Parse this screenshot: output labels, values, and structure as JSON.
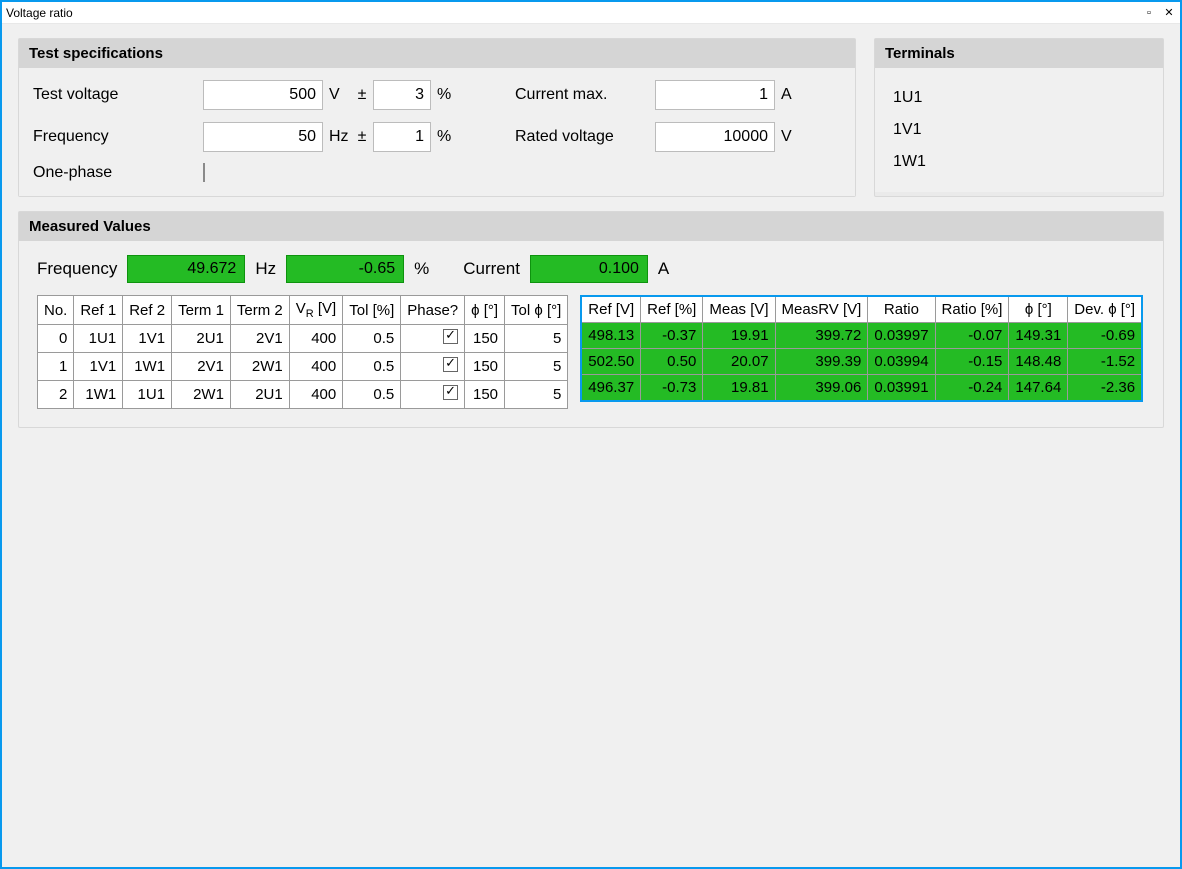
{
  "window": {
    "title": "Voltage ratio"
  },
  "specs": {
    "header": "Test specifications",
    "labels": {
      "test_voltage": "Test voltage",
      "frequency": "Frequency",
      "one_phase": "One-phase",
      "current_max": "Current max.",
      "rated_voltage": "Rated voltage"
    },
    "test_voltage": "500",
    "test_voltage_unit": "V",
    "test_voltage_tol": "3",
    "test_voltage_tol_unit": "%",
    "frequency": "50",
    "frequency_unit": "Hz",
    "frequency_tol": "1",
    "frequency_tol_unit": "%",
    "pm": "±",
    "current_max": "1",
    "current_max_unit": "A",
    "rated_voltage": "10000",
    "rated_voltage_unit": "V",
    "one_phase_checked": false
  },
  "terminals": {
    "header": "Terminals",
    "items": [
      "1U1",
      "1V1",
      "1W1"
    ]
  },
  "measured": {
    "header": "Measured Values",
    "labels": {
      "frequency": "Frequency",
      "hz": "Hz",
      "pct": "%",
      "current": "Current",
      "amp": "A"
    },
    "frequency_val": "49.672",
    "pct_val": "-0.65",
    "current_val": "0.100"
  },
  "left_table": {
    "headers": [
      "No.",
      "Ref 1",
      "Ref 2",
      "Term 1",
      "Term 2",
      "V_R [V]",
      "Tol [%]",
      "Phase?",
      "ϕ [°]",
      "Tol ϕ [°]"
    ],
    "rows": [
      {
        "no": "0",
        "ref1": "1U1",
        "ref2": "1V1",
        "t1": "2U1",
        "t2": "2V1",
        "vr": "400",
        "tol": "0.5",
        "phase": true,
        "phi": "150",
        "tolphi": "5"
      },
      {
        "no": "1",
        "ref1": "1V1",
        "ref2": "1W1",
        "t1": "2V1",
        "t2": "2W1",
        "vr": "400",
        "tol": "0.5",
        "phase": true,
        "phi": "150",
        "tolphi": "5"
      },
      {
        "no": "2",
        "ref1": "1W1",
        "ref2": "1U1",
        "t1": "2W1",
        "t2": "2U1",
        "vr": "400",
        "tol": "0.5",
        "phase": true,
        "phi": "150",
        "tolphi": "5"
      }
    ]
  },
  "right_table": {
    "headers": [
      "Ref [V]",
      "Ref [%]",
      "Meas [V]",
      "MeasRV [V]",
      "Ratio",
      "Ratio [%]",
      "ϕ [°]",
      "Dev. ϕ [°]"
    ],
    "rows": [
      {
        "refv": "498.13",
        "refp": "-0.37",
        "meas": "19.91",
        "measrv": "399.72",
        "ratio": "0.03997",
        "ratiop": "-0.07",
        "phi": "149.31",
        "dev": "-0.69"
      },
      {
        "refv": "502.50",
        "refp": "0.50",
        "meas": "20.07",
        "measrv": "399.39",
        "ratio": "0.03994",
        "ratiop": "-0.15",
        "phi": "148.48",
        "dev": "-1.52"
      },
      {
        "refv": "496.37",
        "refp": "-0.73",
        "meas": "19.81",
        "measrv": "399.06",
        "ratio": "0.03991",
        "ratiop": "-0.24",
        "phi": "147.64",
        "dev": "-2.36"
      }
    ]
  },
  "colors": {
    "accent_green": "#24bb24",
    "window_border": "#0899ee"
  }
}
